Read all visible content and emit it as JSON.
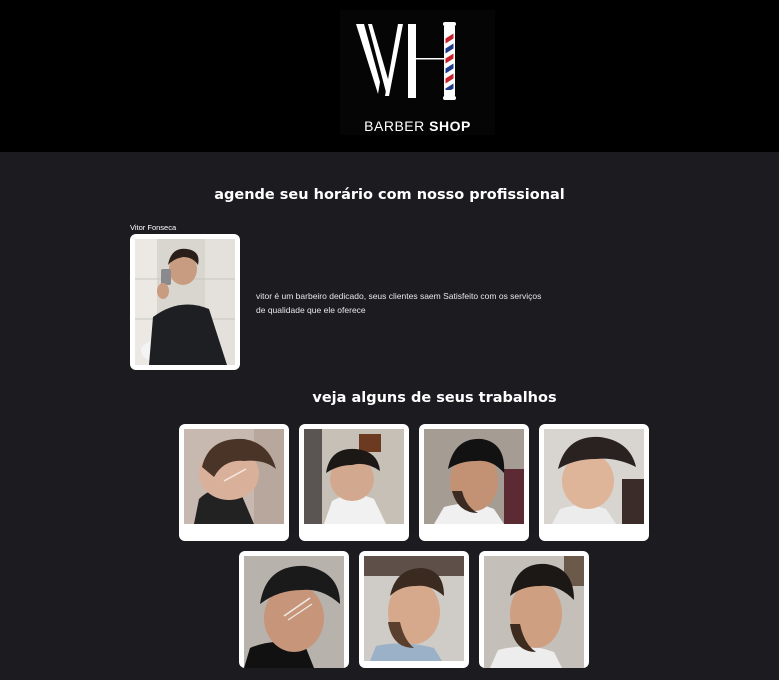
{
  "brand": {
    "logo_mark": "VH",
    "name_light": "BARBER",
    "name_bold": "SHOP"
  },
  "booking": {
    "title": "agende seu horário com nosso profissional"
  },
  "professional": {
    "name": "Vitor Fonseca",
    "description": "vitor é um barbeiro dedicado, seus clientes saem Satisfeito com os serviços de qualidade que ele oferece"
  },
  "works": {
    "title": "veja alguns de seus trabalhos",
    "items": [
      {
        "label": "haircut-photo-1"
      },
      {
        "label": "haircut-photo-2"
      },
      {
        "label": "haircut-photo-3"
      },
      {
        "label": "haircut-photo-4"
      },
      {
        "label": "haircut-photo-5"
      },
      {
        "label": "haircut-photo-6"
      },
      {
        "label": "haircut-photo-7"
      }
    ]
  },
  "colors": {
    "header_bg": "#000000",
    "page_bg": "#1b1b20",
    "card_bg": "#ffffff",
    "pole_red": "#c8202a",
    "pole_blue": "#1f3a8a"
  }
}
